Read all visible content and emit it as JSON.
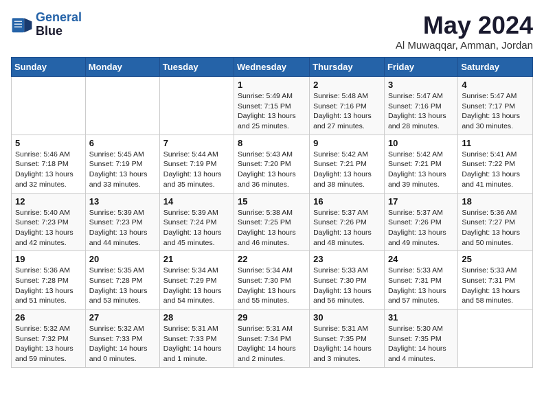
{
  "header": {
    "logo_line1": "General",
    "logo_line2": "Blue",
    "month_title": "May 2024",
    "location": "Al Muwaqqar, Amman, Jordan"
  },
  "days_of_week": [
    "Sunday",
    "Monday",
    "Tuesday",
    "Wednesday",
    "Thursday",
    "Friday",
    "Saturday"
  ],
  "weeks": [
    [
      {
        "num": "",
        "info": ""
      },
      {
        "num": "",
        "info": ""
      },
      {
        "num": "",
        "info": ""
      },
      {
        "num": "1",
        "info": "Sunrise: 5:49 AM\nSunset: 7:15 PM\nDaylight: 13 hours\nand 25 minutes."
      },
      {
        "num": "2",
        "info": "Sunrise: 5:48 AM\nSunset: 7:16 PM\nDaylight: 13 hours\nand 27 minutes."
      },
      {
        "num": "3",
        "info": "Sunrise: 5:47 AM\nSunset: 7:16 PM\nDaylight: 13 hours\nand 28 minutes."
      },
      {
        "num": "4",
        "info": "Sunrise: 5:47 AM\nSunset: 7:17 PM\nDaylight: 13 hours\nand 30 minutes."
      }
    ],
    [
      {
        "num": "5",
        "info": "Sunrise: 5:46 AM\nSunset: 7:18 PM\nDaylight: 13 hours\nand 32 minutes."
      },
      {
        "num": "6",
        "info": "Sunrise: 5:45 AM\nSunset: 7:19 PM\nDaylight: 13 hours\nand 33 minutes."
      },
      {
        "num": "7",
        "info": "Sunrise: 5:44 AM\nSunset: 7:19 PM\nDaylight: 13 hours\nand 35 minutes."
      },
      {
        "num": "8",
        "info": "Sunrise: 5:43 AM\nSunset: 7:20 PM\nDaylight: 13 hours\nand 36 minutes."
      },
      {
        "num": "9",
        "info": "Sunrise: 5:42 AM\nSunset: 7:21 PM\nDaylight: 13 hours\nand 38 minutes."
      },
      {
        "num": "10",
        "info": "Sunrise: 5:42 AM\nSunset: 7:21 PM\nDaylight: 13 hours\nand 39 minutes."
      },
      {
        "num": "11",
        "info": "Sunrise: 5:41 AM\nSunset: 7:22 PM\nDaylight: 13 hours\nand 41 minutes."
      }
    ],
    [
      {
        "num": "12",
        "info": "Sunrise: 5:40 AM\nSunset: 7:23 PM\nDaylight: 13 hours\nand 42 minutes."
      },
      {
        "num": "13",
        "info": "Sunrise: 5:39 AM\nSunset: 7:23 PM\nDaylight: 13 hours\nand 44 minutes."
      },
      {
        "num": "14",
        "info": "Sunrise: 5:39 AM\nSunset: 7:24 PM\nDaylight: 13 hours\nand 45 minutes."
      },
      {
        "num": "15",
        "info": "Sunrise: 5:38 AM\nSunset: 7:25 PM\nDaylight: 13 hours\nand 46 minutes."
      },
      {
        "num": "16",
        "info": "Sunrise: 5:37 AM\nSunset: 7:26 PM\nDaylight: 13 hours\nand 48 minutes."
      },
      {
        "num": "17",
        "info": "Sunrise: 5:37 AM\nSunset: 7:26 PM\nDaylight: 13 hours\nand 49 minutes."
      },
      {
        "num": "18",
        "info": "Sunrise: 5:36 AM\nSunset: 7:27 PM\nDaylight: 13 hours\nand 50 minutes."
      }
    ],
    [
      {
        "num": "19",
        "info": "Sunrise: 5:36 AM\nSunset: 7:28 PM\nDaylight: 13 hours\nand 51 minutes."
      },
      {
        "num": "20",
        "info": "Sunrise: 5:35 AM\nSunset: 7:28 PM\nDaylight: 13 hours\nand 53 minutes."
      },
      {
        "num": "21",
        "info": "Sunrise: 5:34 AM\nSunset: 7:29 PM\nDaylight: 13 hours\nand 54 minutes."
      },
      {
        "num": "22",
        "info": "Sunrise: 5:34 AM\nSunset: 7:30 PM\nDaylight: 13 hours\nand 55 minutes."
      },
      {
        "num": "23",
        "info": "Sunrise: 5:33 AM\nSunset: 7:30 PM\nDaylight: 13 hours\nand 56 minutes."
      },
      {
        "num": "24",
        "info": "Sunrise: 5:33 AM\nSunset: 7:31 PM\nDaylight: 13 hours\nand 57 minutes."
      },
      {
        "num": "25",
        "info": "Sunrise: 5:33 AM\nSunset: 7:31 PM\nDaylight: 13 hours\nand 58 minutes."
      }
    ],
    [
      {
        "num": "26",
        "info": "Sunrise: 5:32 AM\nSunset: 7:32 PM\nDaylight: 13 hours\nand 59 minutes."
      },
      {
        "num": "27",
        "info": "Sunrise: 5:32 AM\nSunset: 7:33 PM\nDaylight: 14 hours\nand 0 minutes."
      },
      {
        "num": "28",
        "info": "Sunrise: 5:31 AM\nSunset: 7:33 PM\nDaylight: 14 hours\nand 1 minute."
      },
      {
        "num": "29",
        "info": "Sunrise: 5:31 AM\nSunset: 7:34 PM\nDaylight: 14 hours\nand 2 minutes."
      },
      {
        "num": "30",
        "info": "Sunrise: 5:31 AM\nSunset: 7:35 PM\nDaylight: 14 hours\nand 3 minutes."
      },
      {
        "num": "31",
        "info": "Sunrise: 5:30 AM\nSunset: 7:35 PM\nDaylight: 14 hours\nand 4 minutes."
      },
      {
        "num": "",
        "info": ""
      }
    ]
  ]
}
